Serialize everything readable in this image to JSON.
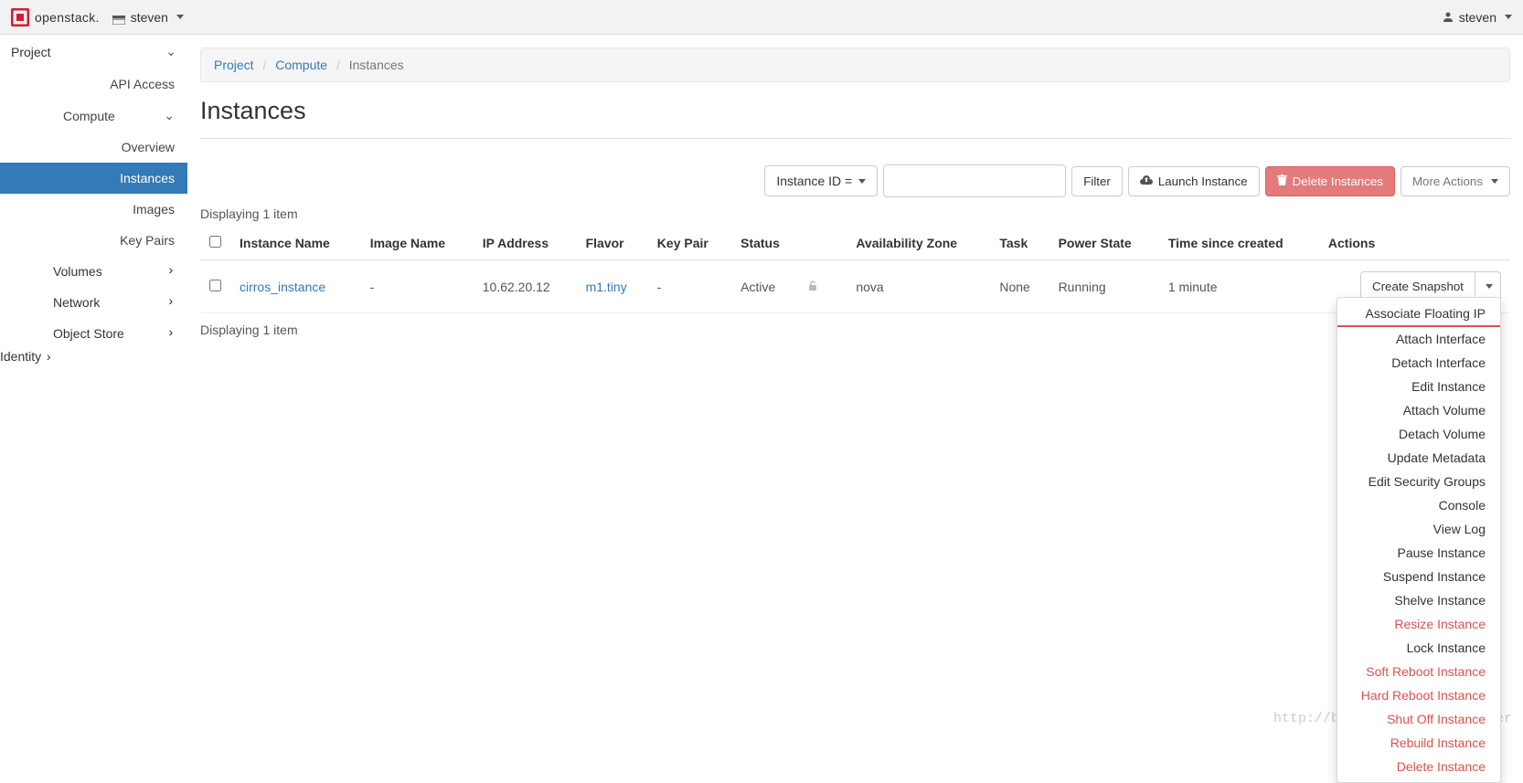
{
  "topbar": {
    "brand": "openstack.",
    "project": "steven",
    "user": "steven"
  },
  "sidebar": {
    "project": "Project",
    "api_access": "API Access",
    "compute": "Compute",
    "overview": "Overview",
    "instances": "Instances",
    "images": "Images",
    "key_pairs": "Key Pairs",
    "volumes": "Volumes",
    "network": "Network",
    "object_store": "Object Store",
    "identity": "Identity"
  },
  "breadcrumb": {
    "project": "Project",
    "compute": "Compute",
    "instances": "Instances"
  },
  "page_title": "Instances",
  "toolbar": {
    "filter_field": "Instance ID =",
    "filter_placeholder": "",
    "filter_btn": "Filter",
    "launch": "Launch Instance",
    "delete": "Delete Instances",
    "more": "More Actions"
  },
  "table": {
    "displaying": "Displaying 1 item",
    "headers": {
      "name": "Instance Name",
      "image": "Image Name",
      "ip": "IP Address",
      "flavor": "Flavor",
      "keypair": "Key Pair",
      "status": "Status",
      "az": "Availability Zone",
      "task": "Task",
      "power": "Power State",
      "time": "Time since created",
      "actions": "Actions"
    },
    "row": {
      "name": "cirros_instance",
      "image": "-",
      "ip": "10.62.20.12",
      "flavor": "m1.tiny",
      "keypair": "-",
      "status": "Active",
      "az": "nova",
      "task": "None",
      "power": "Running",
      "time": "1 minute",
      "action_primary": "Create Snapshot"
    }
  },
  "actions_menu": [
    {
      "label": "Associate Floating IP",
      "danger": false,
      "first": true
    },
    {
      "label": "Attach Interface",
      "danger": false
    },
    {
      "label": "Detach Interface",
      "danger": false
    },
    {
      "label": "Edit Instance",
      "danger": false
    },
    {
      "label": "Attach Volume",
      "danger": false
    },
    {
      "label": "Detach Volume",
      "danger": false
    },
    {
      "label": "Update Metadata",
      "danger": false
    },
    {
      "label": "Edit Security Groups",
      "danger": false
    },
    {
      "label": "Console",
      "danger": false
    },
    {
      "label": "View Log",
      "danger": false
    },
    {
      "label": "Pause Instance",
      "danger": false
    },
    {
      "label": "Suspend Instance",
      "danger": false
    },
    {
      "label": "Shelve Instance",
      "danger": false
    },
    {
      "label": "Resize Instance",
      "danger": true
    },
    {
      "label": "Lock Instance",
      "danger": false
    },
    {
      "label": "Soft Reboot Instance",
      "danger": true
    },
    {
      "label": "Hard Reboot Instance",
      "danger": true
    },
    {
      "label": "Shut Off Instance",
      "danger": true
    },
    {
      "label": "Rebuild Instance",
      "danger": true
    },
    {
      "label": "Delete Instance",
      "danger": true
    }
  ],
  "watermark": "http://blog.csdn.net/songqier"
}
